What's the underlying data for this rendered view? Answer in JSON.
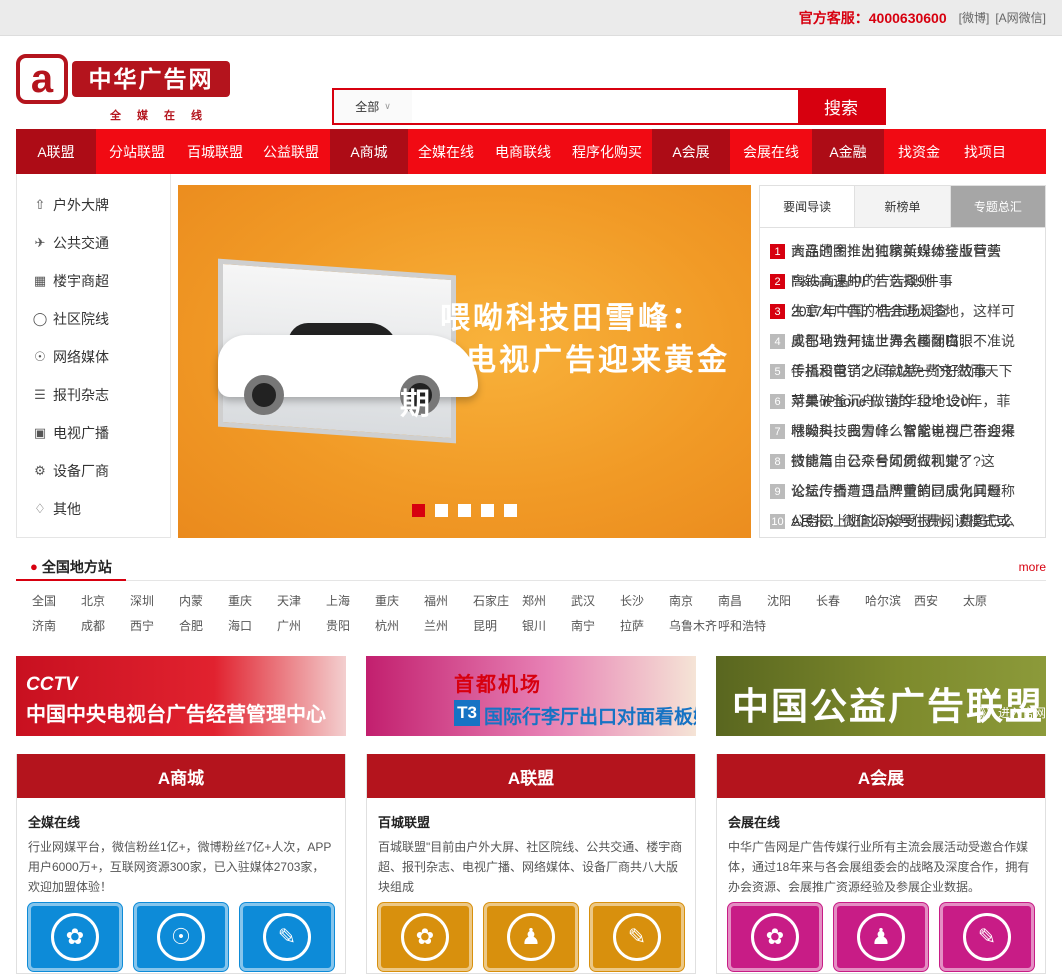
{
  "topbar": {
    "hotline": "官方客服：4000630600",
    "weibo": "[微博]",
    "wechat": "[A网微信]"
  },
  "logo": {
    "mark": "a",
    "name": "中华广告网",
    "tagline": "全媒在线"
  },
  "search": {
    "category": "全部",
    "placeholder": "",
    "button": "搜索"
  },
  "nav": {
    "groups": [
      {
        "head": "A联盟",
        "items": [
          "分站联盟",
          "百城联盟",
          "公益联盟"
        ]
      },
      {
        "head": "A商城",
        "items": [
          "全媒在线",
          "电商联线",
          "程序化购买"
        ]
      },
      {
        "head": "A会展",
        "items": [
          "会展在线"
        ]
      },
      {
        "head": "A金融",
        "items": [
          "找资金",
          "找项目"
        ]
      }
    ]
  },
  "sidebar": {
    "items": [
      {
        "label": "户外大牌",
        "icon": "billboard-icon"
      },
      {
        "label": "公共交通",
        "icon": "plane-icon"
      },
      {
        "label": "楼宇商超",
        "icon": "building-icon"
      },
      {
        "label": "社区院线",
        "icon": "community-icon"
      },
      {
        "label": "网络媒体",
        "icon": "globe-icon"
      },
      {
        "label": "报刊杂志",
        "icon": "books-icon"
      },
      {
        "label": "电视广播",
        "icon": "tv-icon"
      },
      {
        "label": "设备厂商",
        "icon": "gear-icon"
      },
      {
        "label": "其他",
        "icon": "tag-icon"
      }
    ]
  },
  "banner": {
    "line1": "喂呦科技田雪峰：",
    "line2": "智能电视广告迎来黄金期",
    "slides": 5,
    "active": 0
  },
  "news": {
    "tabs": [
      "要闻导读",
      "新榜单",
      "专题总汇"
    ],
    "items": [
      {
        "n": "1",
        "a": "商品的图推出独家新媒体全版营营",
        "b": "大连通金：为何精英纷纷转业巨头"
      },
      {
        "n": "2",
        "a": "高铁高速的广告选择9件事",
        "b": "P&G商品中的广告规则"
      },
      {
        "n": "3",
        "a": "2017年中国广告市场调查",
        "b": "生意人广告的机会进入多地，这样可"
      },
      {
        "n": "4",
        "a": "成都地铁开搞世界名画翻白眼",
        "b": "奥巴马为何让上海大楼闭嘴；不准说"
      },
      {
        "n": "5",
        "a": "传播和营销之间就差一个好故事",
        "b": "手机没电了?火车站免费充!然而天下"
      },
      {
        "n": "6",
        "a": "苹果 iPhone 做错的 12个设计",
        "b": "对美破釜沉舟，对华租地120年，菲"
      },
      {
        "n": "7",
        "a": "喂呦科技田雪峰：智能电视广告迎来",
        "b": "林毅夫：我为什么常常说自己不会得"
      },
      {
        "n": "8",
        "a": "技能篇｜公众号如何做视觉?",
        "b": "微博与自己平台同质红利来了?这"
      },
      {
        "n": "9",
        "a": "论坛传播与日益严重的同质化问题",
        "b": "公益广告遭遇品牌营销已成为其母称"
      },
      {
        "n": "10",
        "a": "A民报：微信公众号付费阅读模式或",
        "b": "公务员上班时间接受报刊，费超已么"
      }
    ]
  },
  "region": {
    "title": "全国地方站",
    "more": "more",
    "cities": [
      "全国",
      "北京",
      "深圳",
      "内蒙",
      "重庆",
      "天津",
      "上海",
      "重庆",
      "福州",
      "石家庄",
      "郑州",
      "武汉",
      "长沙",
      "南京",
      "南昌",
      "沈阳",
      "长春",
      "哈尔滨",
      "西安",
      "太原",
      "济南",
      "成都",
      "西宁",
      "合肥",
      "海口",
      "广州",
      "贵阳",
      "杭州",
      "兰州",
      "昆明",
      "银川",
      "南宁",
      "拉萨",
      "乌鲁木齐",
      "呼和浩特"
    ]
  },
  "ads": {
    "cctv_logo": "CCTV",
    "cctv_text": "中国中央电视台广告经营管理中心",
    "airport_l1": "首都机场",
    "airport_t3": "T3",
    "airport_l2": "国际行李厅出口对面看板媒体招商",
    "gongyi_text": "中国公益广告联盟",
    "gongyi_go": "》》进入官网"
  },
  "cards": [
    {
      "head": "A商城",
      "title": "全媒在线",
      "desc": "行业网媒平台，微信粉丝1亿+，微博粉丝7亿+人次，APP用户6000万+，互联网资源300家，已入驻媒体2703家，欢迎加盟体验！",
      "theme": "#0d8bd8",
      "icons": [
        "leaf-icon",
        "globe-plus-icon",
        "edit-icon"
      ]
    },
    {
      "head": "A联盟",
      "title": "百城联盟",
      "desc": "百城联盟\"目前由户外大屏、社区院线、公共交通、楼宇商超、报刊杂志、电视广播、网络媒体、设备厂商共八大版块组成",
      "theme": "#d8900d",
      "icons": [
        "leaf-icon",
        "user-plus-icon",
        "edit-icon"
      ]
    },
    {
      "head": "A会展",
      "title": "会展在线",
      "desc": "中华广告网是广告传媒行业所有主流会展活动受邀合作媒体，通过18年来与各会展组委会的战略及深度合作，拥有办会资源、会展推广资源经验及参展企业数据。",
      "theme": "#c81c86",
      "icons": [
        "leaf-icon",
        "user-plus-icon",
        "edit-icon"
      ]
    }
  ]
}
